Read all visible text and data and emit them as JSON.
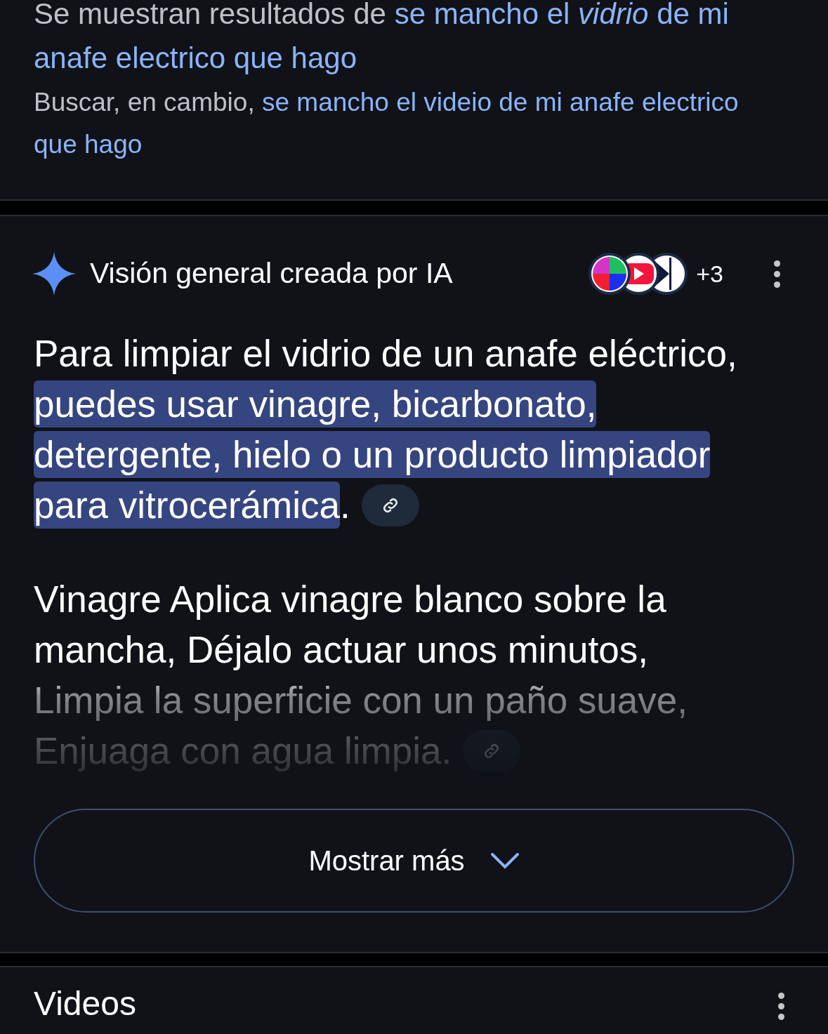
{
  "spelling": {
    "prefix": "Se muestran resultados de",
    "corrected_query": "se mancho el *vidrio* de mi anafe electrico que hago",
    "alternative_prefix": "Buscar, en cambio,",
    "alternative_query": "se mancho el videio de mi anafe electrico que hago"
  },
  "ai_overview": {
    "title": "Visión general creada por IA",
    "more_sources": "+3",
    "paragraphs": [
      {
        "lead": "Para limpiar el vidrio de un anafe eléctrico, ",
        "highlight": "puedes usar vinagre, bicarbonato, detergente, hielo o un producto limpiador para vitrocerámica",
        "tail": ".",
        "faded": false
      },
      {
        "lead": "Vinagre Aplica vinagre blanco sobre la mancha, Déjalo actuar unos minutos, Limpia la superficie con un paño suave, Enjuaga con agua limpia.",
        "faded": true
      }
    ],
    "show_more": "Mostrar más"
  },
  "videos": {
    "title": "Videos"
  }
}
